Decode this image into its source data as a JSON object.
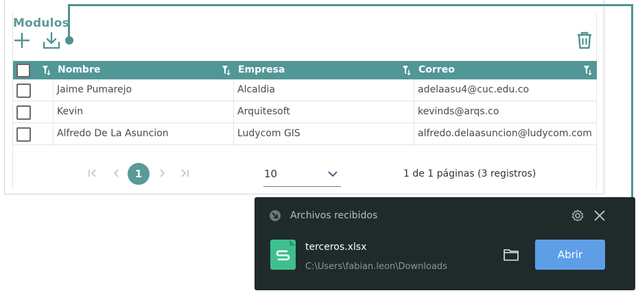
{
  "panel": {
    "title": "Modulos"
  },
  "toolbar": {
    "add_icon": "plus-icon",
    "download_icon": "download-icon",
    "delete_icon": "trash-icon"
  },
  "grid": {
    "columns": [
      "Nombre",
      "Empresa",
      "Correo"
    ],
    "rows": [
      {
        "nombre": "Jaime Pumarejo",
        "empresa": "Alcaldia",
        "correo": "adelaasu4@cuc.edu.co"
      },
      {
        "nombre": "Kevin",
        "empresa": "Arquitesoft",
        "correo": "kevinds@arqs.co"
      },
      {
        "nombre": "Alfredo De La Asuncion",
        "empresa": "Ludycom GIS",
        "correo": "alfredo.delaasuncion@ludycom.com"
      }
    ]
  },
  "pager": {
    "current_page": "1",
    "page_size": "10",
    "info": "1 de 1 páginas (3 registros)"
  },
  "download_toast": {
    "title": "Archivos recibidos",
    "file_name": "terceros.xlsx",
    "file_path": "C:\\Users\\fabian.leon\\Downloads",
    "open_label": "Abrir"
  },
  "colors": {
    "accent": "#5a9a98",
    "header": "#529797",
    "toast_bg": "#1f2b2b",
    "open_button": "#5e9ee7",
    "file_icon": "#3fbf8e"
  }
}
